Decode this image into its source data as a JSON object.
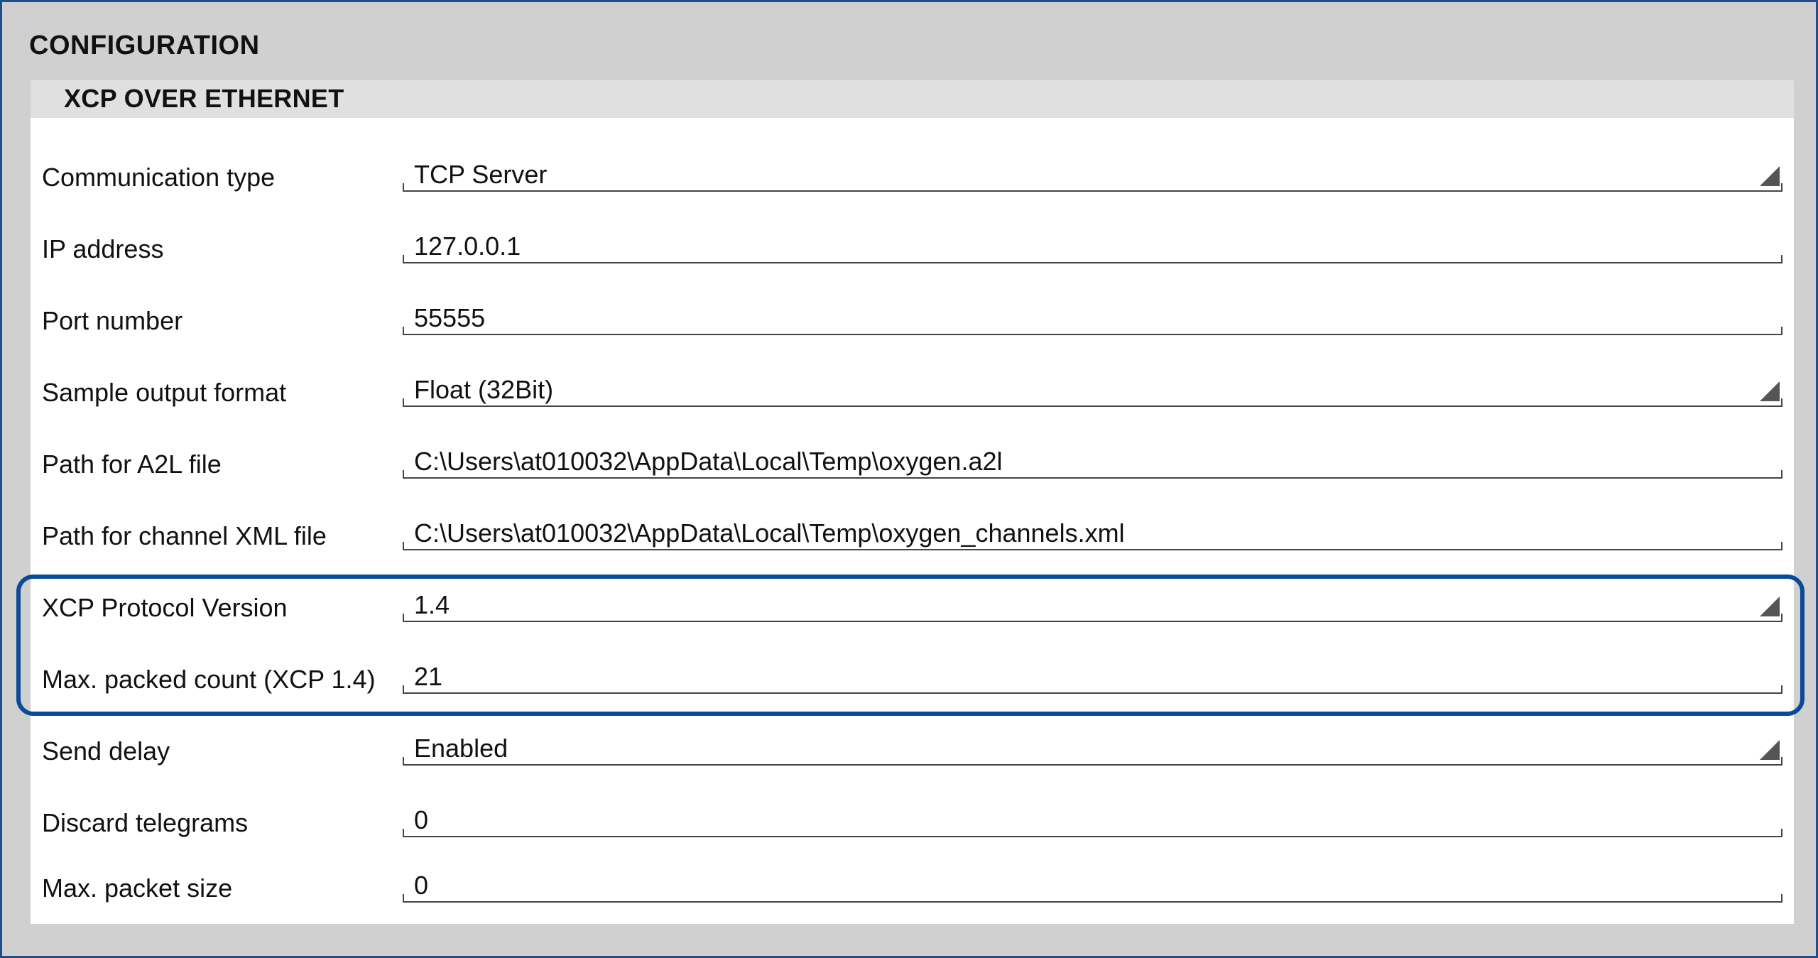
{
  "section": {
    "title": "CONFIGURATION"
  },
  "panel": {
    "title": "XCP OVER ETHERNET"
  },
  "fields": [
    {
      "label": "Communication type",
      "value": "TCP Server",
      "kind": "dropdown"
    },
    {
      "label": "IP address",
      "value": "127.0.0.1",
      "kind": "text"
    },
    {
      "label": "Port number",
      "value": "55555",
      "kind": "text"
    },
    {
      "label": "Sample output format",
      "value": "Float (32Bit)",
      "kind": "dropdown"
    },
    {
      "label": "Path for A2L file",
      "value": "C:\\Users\\at010032\\AppData\\Local\\Temp\\oxygen.a2l",
      "kind": "text"
    },
    {
      "label": "Path for channel XML file",
      "value": "C:\\Users\\at010032\\AppData\\Local\\Temp\\oxygen_channels.xml",
      "kind": "text"
    },
    {
      "label": "XCP Protocol Version",
      "value": "1.4",
      "kind": "dropdown"
    },
    {
      "label": "Max. packed count (XCP 1.4)",
      "value": "21",
      "kind": "text"
    },
    {
      "label": "Send delay",
      "value": "Enabled",
      "kind": "dropdown"
    },
    {
      "label": "Discard telegrams",
      "value": "0",
      "kind": "text"
    },
    {
      "label": "Max. packet size",
      "value": "0",
      "kind": "text"
    }
  ],
  "icons": {
    "dropdown": "dropdown-arrow-icon"
  },
  "colors": {
    "highlight": "#0a4a96",
    "header_bg": "#e0e0e0",
    "frame_bg": "#d0d0d0"
  }
}
